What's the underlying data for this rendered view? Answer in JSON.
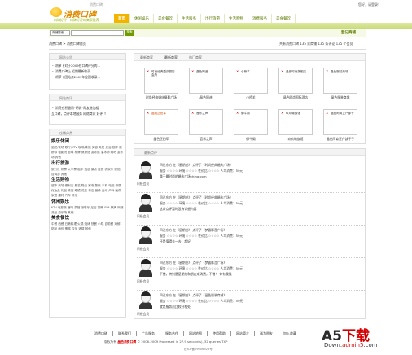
{
  "header": {
    "logo_text": "消费口碑",
    "logo_sub": "消费口碑",
    "slogan": "口碑好评 · 口碑好评的商家推荐",
    "user_links": "您好，请登录！"
  },
  "nav": [
    "首页",
    "休闲娱乐",
    "美食餐饮",
    "生活服务",
    "出行旅游",
    "生活购物",
    "消费服务",
    "美食餐饮"
  ],
  "search": {
    "select_value": "商铺搜索",
    "button": "搜索",
    "login": "登记商铺"
  },
  "breadcrumb": "消费口碑 > 消费口碑首页",
  "total_text": "共有消费口碑 135 家商铺 135 条评论 135 个会员",
  "left": {
    "news_title": "网站公告",
    "news": [
      "・ 胡萝卜对于2009在口碑评分的…",
      "・ 消费口碑上 近期最新收录…",
      "・ 胡萝卜团站点2009年全国收录…"
    ],
    "merchant_title": "网站商讯",
    "merchant_news": [
      "・ 消费在积极同“胡说”网友增加相",
      "  互口碑，点评本地服务 网络商家 好评 ↑"
    ],
    "cat_title": "店铺分类",
    "categories": [
      {
        "name": "娱乐休闲",
        "items": "酒吧/夜场 歌厅/KTV 咖啡/茶馆 美容 美发 足浴 按摩 保龄球 电影院 台球 棋牌 健身馆 游泳馆 溜冰场 网吧 游乐场 其他"
      },
      {
        "name": "出行旅游",
        "items": "旅行社 机票 火车票 租车 酒店 景点 度假 农家乐 宾馆 自驾游 其他"
      },
      {
        "name": "生活购物",
        "items": "超市 商场 便利店 服装 鞋包 家电 数码 手机 电脑 母婴 化妆品 礼品 珠宝 眼镜 花店 书店 音像 运动 户外 医药 家居 建材 汽车 其他"
      },
      {
        "name": "休闲娱乐",
        "items": "KTV 电影院 酒吧 茶馆 咖啡厅 足浴 按摩 SPA 棋牌 网吧 洗浴 游乐场 其他"
      },
      {
        "name": "美食餐饮",
        "items": "中餐 西餐 日韩料理 火锅 烧烤 快餐 小吃 自助餐 海鲜 甜品 面包 蛋糕 饮品 酒楼 其他"
      }
    ]
  },
  "store_panel": {
    "tabs": [
      "最新商家",
      "最新商家",
      "热门商家"
    ],
    "merchants": [
      {
        "img_text": "时尚经典婚庆摄影会所",
        "name": "时尚经典婚庆摄影广场",
        "orange": false
      },
      {
        "img_text": "晶色阿迪",
        "name": "晶色阿迪",
        "orange": false
      },
      {
        "img_text": "小桥羊",
        "name": "小桥羊",
        "orange": false
      },
      {
        "img_text": "晶色时尚旗舰店",
        "name": "晶色时尚国际酒店",
        "orange": false
      },
      {
        "img_text": "晶色服装商城",
        "name": "晶色服装商城",
        "orange": false
      },
      {
        "img_text": "晶色正拍军",
        "name": "晶色正拍军",
        "orange": true
      },
      {
        "img_text": "音乐之声",
        "name": "音乐之声",
        "orange": false
      },
      {
        "img_text": "御牛阁",
        "name": "御牛阁",
        "orange": false
      },
      {
        "img_text": "玖玖瑜伽馆",
        "name": "玖玖瑜伽馆",
        "orange": false
      },
      {
        "img_text": "晶色阿育正户部千",
        "name": "晶色阿育正户部千子",
        "orange": false
      }
    ]
  },
  "reviews_panel": {
    "title": "最新点评",
    "reviews": [
      {
        "user": "积极会员",
        "line1": "四达东方 在《星期拍》 点评了《时尚经典婚庆广场》",
        "line2": "服务 ☆☆☆☆ 环境 ☆☆☆☆ 性价比 ☆☆☆☆ 人均消费：50元",
        "line3": "属于最时尚的婚庆广场china.com"
      },
      {
        "user": "积极会员",
        "line1": "四达东方 在《星期拍》 点评了《时尚经典婚庆广场》",
        "line2": "服务 ☆☆☆☆ 环境 ☆☆☆☆ 性价比 ☆☆☆☆ 人均消费：50元",
        "line3": "这条点评暂时没有详细内容"
      },
      {
        "user": "积极会员",
        "line1": "四达东方 在《星期拍》 点评了《梦露影音广场》",
        "line2": "服务 ☆☆☆☆ 环境 ☆☆☆☆ 性价比 ☆☆☆☆ 人均消费：50元",
        "line3": "还是值得去一去，超好"
      },
      {
        "user": "积极会员",
        "line1": "四达东方 在《星期拍》 点评了《梦露影音广场》",
        "line2": "服务 ☆☆☆☆ 环境 ☆☆☆☆ 性价比 ☆☆☆☆ 人均消费：50元",
        "line3": "不错，特别是星期拍和朋友来消费，不错！ 你有我找"
      },
      {
        "user": "积极会员",
        "line1": "四达东方 在《星期拍》 点评了《晶色服装商城》",
        "line2": "服务 ☆☆☆☆ 环境 ☆☆☆☆ 性价比 ☆☆☆☆ 人均消费：50元",
        "line3": "就是服务员比较好相处"
      }
    ]
  },
  "footer": {
    "links": [
      "消费口碑",
      "联系我们",
      "广告服务",
      "服务合作",
      "网站地图",
      "使用帮助",
      "网站简介",
      "诚为朋友",
      "加入收藏"
    ],
    "copyright_pre": "版权所有",
    "site": "晶色消费口碑",
    "copyright_post": "© 2006-2009 Processed in 27.9 second(s), 32 queries TXP",
    "icp": "陕ICP备09006928号"
  },
  "watermark": {
    "a5": "A5",
    "xia": "下载",
    "url_pre": "Down.",
    "url_mid": "admin5",
    "url_post": ".com"
  }
}
